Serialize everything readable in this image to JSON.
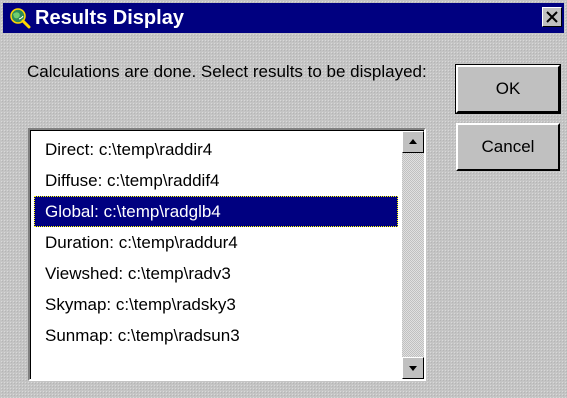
{
  "window": {
    "title": "Results Display",
    "icon": "globe-magnifier-icon",
    "close_icon": "close-icon"
  },
  "prompt": "Calculations are done. Select results to be displayed:",
  "buttons": {
    "ok_label": "OK",
    "cancel_label": "Cancel"
  },
  "results": {
    "selected_index": 2,
    "items": [
      {
        "label": "Direct: c:\\temp\\raddir4"
      },
      {
        "label": "Diffuse: c:\\temp\\raddif4"
      },
      {
        "label": "Global: c:\\temp\\radglb4"
      },
      {
        "label": "Duration: c:\\temp\\raddur4"
      },
      {
        "label": "Viewshed: c:\\temp\\radv3"
      },
      {
        "label": "Skymap: c:\\temp\\radsky3"
      },
      {
        "label": "Sunmap: c:\\temp\\radsun3"
      }
    ]
  },
  "colors": {
    "titlebar": "#000080",
    "selection": "#000080",
    "face": "#c0c0c0"
  }
}
